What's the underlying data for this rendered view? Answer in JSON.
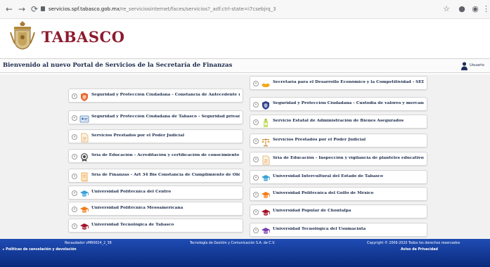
{
  "browser": {
    "url_host": "servicios.spf.tabasco.gob.mx",
    "url_path": "/re_serviciosinternet/faces/servicios?_adf.ctrl-state=i7csebjrq_3"
  },
  "header": {
    "brand": "TABASCO",
    "welcome": "Bienvenido al nuevo Portal de Servicios de la Secretaría de Finanzas",
    "user_label": "Usuario"
  },
  "services": {
    "left": [
      {
        "label": "Seguridad y Protección Ciudadana - Constancia de Antecedente no Penal",
        "icon": "shield-icon"
      },
      {
        "label": "Seguridad y Protección Ciudadana de Tabasco - Seguridad privada",
        "icon": "id-card-icon"
      },
      {
        "label": "Servicios Prestados por el Poder Judicial",
        "icon": "document-icon"
      },
      {
        "label": "Sría de Educación - Acreditación y certificación de conocimiento de programa",
        "icon": "award-icon"
      },
      {
        "label": "Sría de Finanzas - Art 34 Bis Constancia de Cumplimiento de Obligaciones",
        "icon": "receipt-icon"
      },
      {
        "label": "Universidad Politécnica del Centro",
        "icon": "graduation-cap-icon"
      },
      {
        "label": "Universidad Politécnica Mesoamericana",
        "icon": "graduation-cap-icon"
      },
      {
        "label": "Universidad Tecnológica de Tabasco",
        "icon": "graduation-cap-icon"
      }
    ],
    "right": [
      {
        "label": "Secretaría para el Desarrollo Económico y la Competitividad - SEDEC",
        "icon": "handshake-icon"
      },
      {
        "label": "Seguridad y Protección Ciudadana - Custodia de valores y mercancía",
        "icon": "shield-icon"
      },
      {
        "label": "Servicio Estatal de Administración de Bienes Asegurados",
        "icon": "bottle-icon"
      },
      {
        "label": "Servicios Prestados por el Poder Judicial",
        "icon": "scales-icon"
      },
      {
        "label": "Sría de Educación - Inspección y vigilancia de planteles educativos particulares",
        "icon": "document-icon"
      },
      {
        "label": "Universidad Intercultural del Estado de Tabasco",
        "icon": "graduation-cap-icon"
      },
      {
        "label": "Universidad Politécnica del Golfo de México",
        "icon": "graduation-cap-icon"
      },
      {
        "label": "Universidad Popular de Chontalpa",
        "icon": "graduation-cap-icon"
      },
      {
        "label": "Universidad Tecnológica del Usumacinta",
        "icon": "graduation-cap-icon"
      }
    ]
  },
  "footer": {
    "version": "Recaudador vMR0024_2_38",
    "policies": "Políticas de cancelación y devolución",
    "company": "Tecnología de Gestión y Comunicación S.A. de C.V.",
    "copyright": "Copyright © 2006-2020 Todos los derechos reservados",
    "privacy": "Aviso de Privacidad"
  },
  "colors": {
    "brand": "#8c1a2e",
    "title_text": "#1b2a4b",
    "footer_bg": "#0a2a7c",
    "area_bg": "#f1f1f1"
  }
}
